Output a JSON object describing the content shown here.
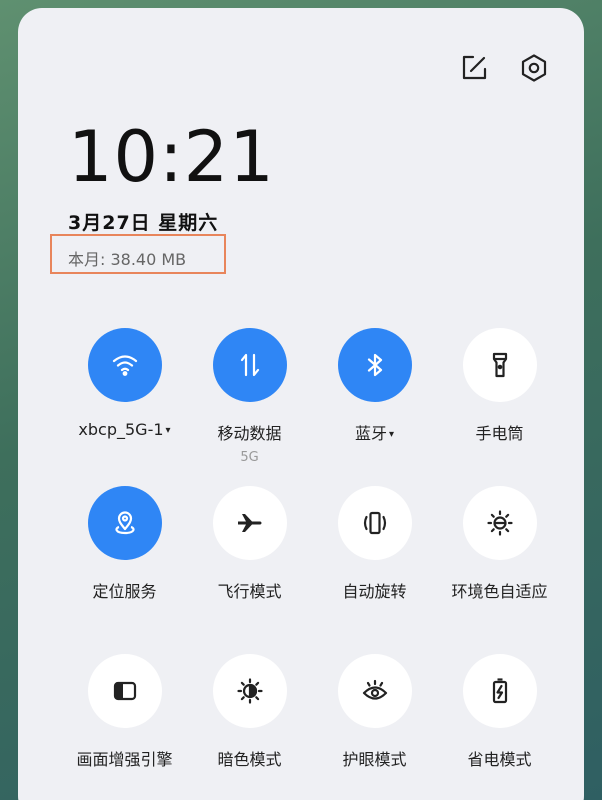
{
  "header": {
    "edit_icon": "edit-icon",
    "settings_icon": "settings-icon"
  },
  "clock": {
    "time": "10:21"
  },
  "date": {
    "text": "3月27日  星期六"
  },
  "data_usage": {
    "text": "本月: 38.40 MB"
  },
  "colors": {
    "active": "#2f86f5",
    "inactive": "#ffffff",
    "highlight_border": "#e8855b"
  },
  "tiles": [
    {
      "label": "xbcp_5G-1",
      "caret": "▾",
      "icon": "wifi-icon",
      "active": true
    },
    {
      "label": "移动数据",
      "sub": "5G",
      "icon": "mobile-data-icon",
      "active": true
    },
    {
      "label": "蓝牙",
      "caret": "▾",
      "icon": "bluetooth-icon",
      "active": true
    },
    {
      "label": "手电筒",
      "icon": "flashlight-icon",
      "active": false
    },
    {
      "label": "定位服务",
      "icon": "location-icon",
      "active": true
    },
    {
      "label": "飞行模式",
      "icon": "airplane-icon",
      "active": false
    },
    {
      "label": "自动旋转",
      "icon": "auto-rotate-icon",
      "active": false
    },
    {
      "label": "环境色自适应",
      "icon": "ambient-color-icon",
      "active": false
    },
    {
      "label": "画面增强引擎",
      "icon": "display-enhance-icon",
      "active": false
    },
    {
      "label": "暗色模式",
      "icon": "dark-mode-icon",
      "active": false
    },
    {
      "label": "护眼模式",
      "icon": "eye-care-icon",
      "active": false
    },
    {
      "label": "省电模式",
      "icon": "battery-saver-icon",
      "active": false
    }
  ]
}
